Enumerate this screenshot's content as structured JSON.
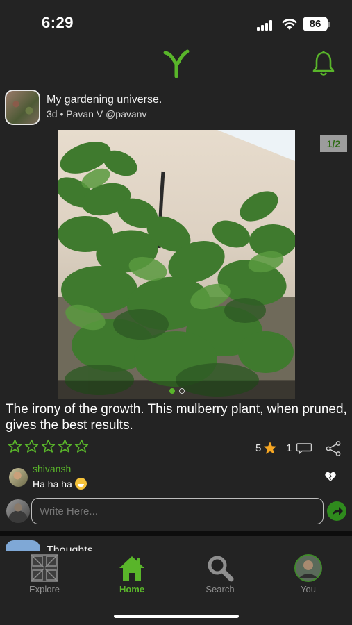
{
  "status_bar": {
    "time": "6:29",
    "battery": "86"
  },
  "post": {
    "title": "My gardening universe.",
    "meta": "3d • Pavan V @pavanv",
    "page_indicator": "1/2",
    "caption": "The irony of the growth. This mulberry plant, when pruned, gives the best results.",
    "rating_count": "5",
    "comment_count": "1",
    "image_count": 2,
    "active_image": 1
  },
  "comment": {
    "username": "shivansh",
    "text": "Ha ha ha"
  },
  "composer": {
    "placeholder": "Write Here..."
  },
  "next_post": {
    "title": "Thoughts"
  },
  "tabs": [
    {
      "label": "Explore",
      "icon": "explore-icon",
      "active": false
    },
    {
      "label": "Home",
      "icon": "home-icon",
      "active": true
    },
    {
      "label": "Search",
      "icon": "search-icon",
      "active": false
    },
    {
      "label": "You",
      "icon": "profile-avatar",
      "active": false
    }
  ],
  "colors": {
    "accent": "#59b52a",
    "background": "#232323",
    "star_filled": "#f5a623",
    "inactive_tab": "#8f8f8f"
  }
}
